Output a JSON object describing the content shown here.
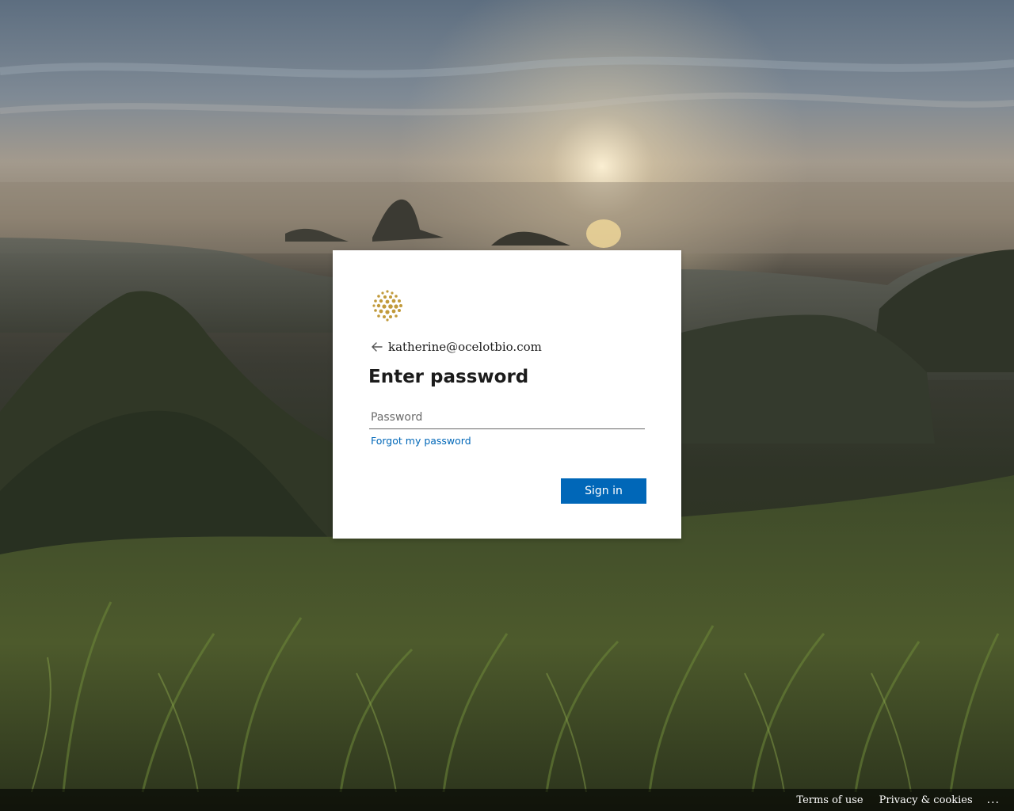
{
  "background": {
    "description": "",
    "accent_color": "#0067b8"
  },
  "card": {
    "logo_icon": "company-logo-icon",
    "logo_color": "#c19a3b",
    "back_icon": "back-arrow-icon",
    "identity_email": "katherine@ocelotbio.com",
    "title": "Enter password",
    "password_placeholder": "Password",
    "password_value": "",
    "forgot_link": "Forgot my password",
    "signin_label": "Sign in"
  },
  "footer": {
    "terms_label": "Terms of use",
    "privacy_label": "Privacy & cookies",
    "more_label": "..."
  }
}
